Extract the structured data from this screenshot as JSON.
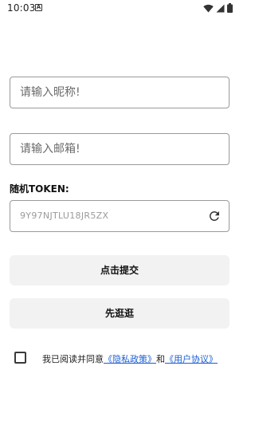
{
  "status_bar": {
    "time": "10:03",
    "notification_icon": "A",
    "wifi_icon": "wifi-icon",
    "signal_icon": "signal-icon",
    "battery_icon": "battery-icon"
  },
  "form": {
    "nickname_placeholder": "请输入昵称!",
    "email_placeholder": "请输入邮箱!",
    "token_label": "随机TOKEN:",
    "token_value": "9Y97NJTLU18JR5ZX",
    "refresh_icon": "refresh-icon"
  },
  "buttons": {
    "submit_label": "点击提交",
    "browse_label": "先逛逛"
  },
  "agreement": {
    "prefix": "我已阅读并同意",
    "privacy_link": "《隐私政策》",
    "connector": "和",
    "user_agreement_link": "《用户协议》"
  },
  "colors": {
    "link": "#1a5fd6",
    "button_bg": "#f2f2f2",
    "border": "#9a9a9a"
  }
}
